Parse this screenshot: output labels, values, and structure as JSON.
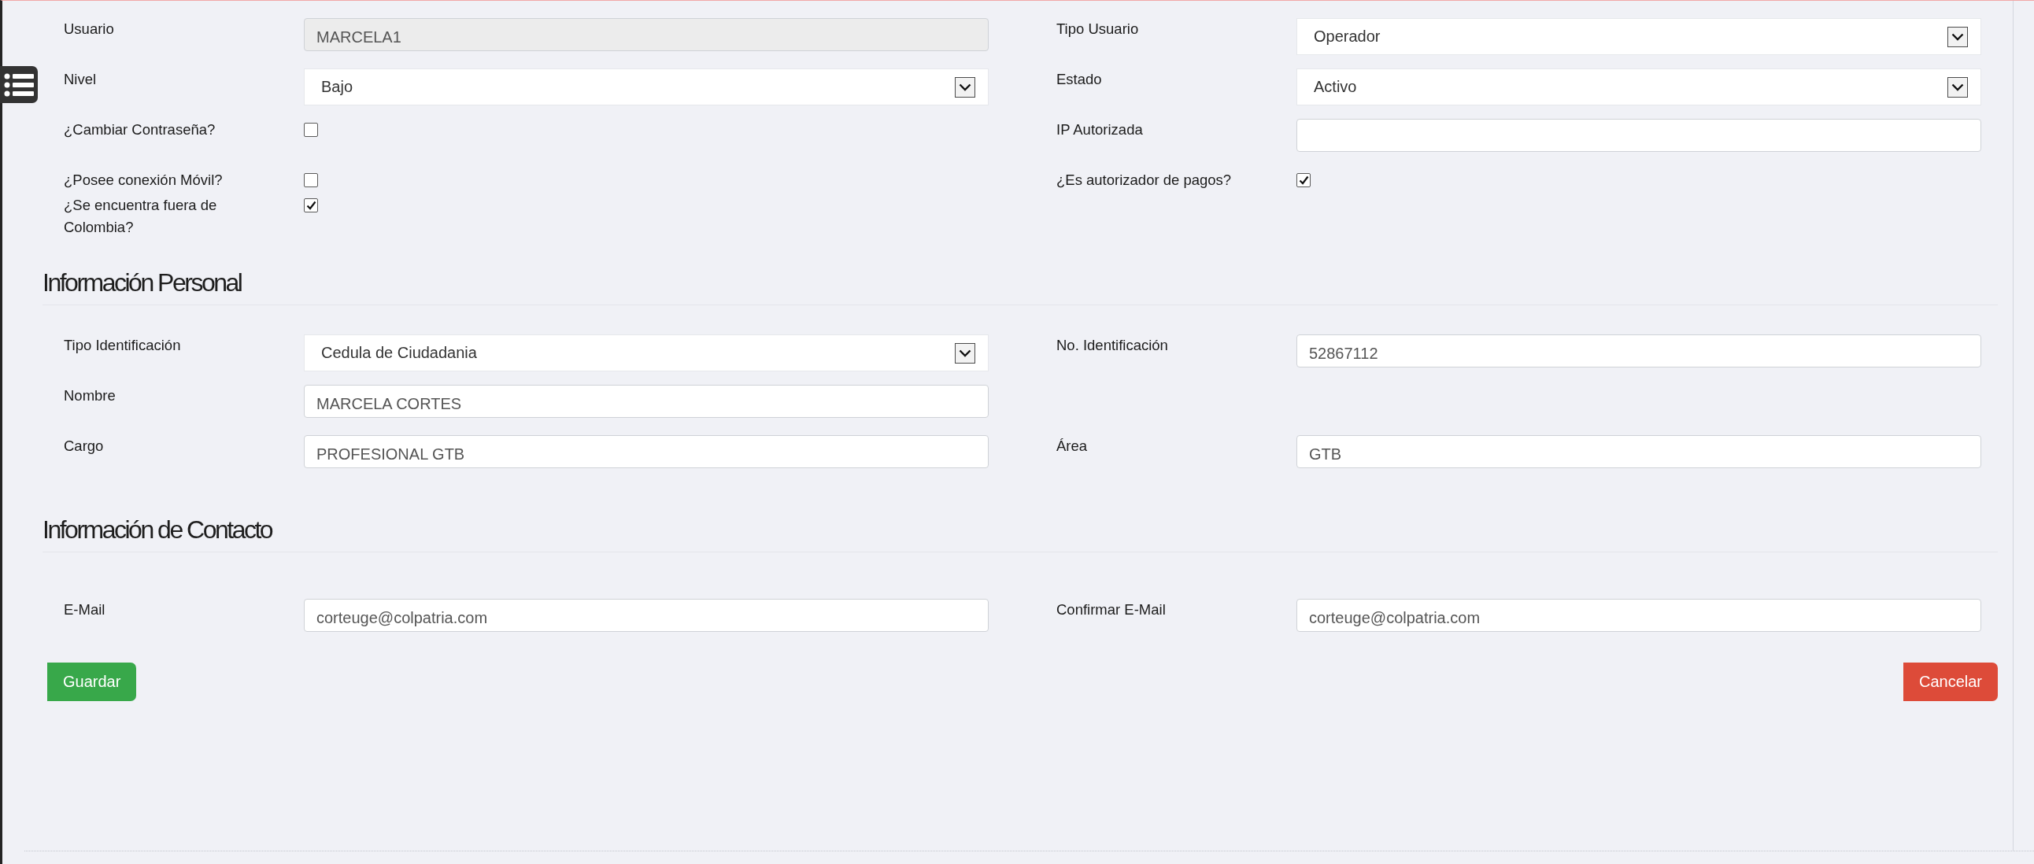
{
  "sections": [
    {
      "rows": [
        {
          "left": {
            "kind": "input",
            "label": "Usuario",
            "value": "MARCELA1",
            "disabled": true
          },
          "right": {
            "kind": "select",
            "label": "Tipo Usuario",
            "value": "Operador"
          }
        },
        {
          "left": {
            "kind": "select",
            "label": "Nivel",
            "value": "Bajo"
          },
          "right": {
            "kind": "select",
            "label": "Estado",
            "value": "Activo"
          }
        },
        {
          "left": {
            "kind": "checkbox",
            "label": "¿Cambiar Contraseña?",
            "checked": false
          },
          "right": {
            "kind": "input",
            "label": "IP Autorizada",
            "disabled": false
          }
        },
        {
          "left": {
            "kind": "checkbox",
            "label": "¿Posee conexión Móvil?",
            "checked": false
          },
          "right": {
            "kind": "checkbox",
            "label": "¿Es autorizador de pagos?",
            "checked": true
          }
        },
        {
          "left": {
            "kind": "checkbox",
            "label": "¿Se encuentra fuera de Colombia?",
            "checked": true
          }
        }
      ]
    },
    {
      "title": "Información Personal",
      "rows": [
        {
          "left": {
            "kind": "select",
            "label": "Tipo Identificación",
            "value": "Cedula de Ciudadania"
          },
          "right": {
            "kind": "input",
            "label": "No. Identificación",
            "value": "52867112",
            "disabled": false
          }
        },
        {
          "left": {
            "kind": "input",
            "label": "Nombre",
            "value": "MARCELA CORTES",
            "disabled": false
          }
        },
        {
          "left": {
            "kind": "input",
            "label": "Cargo",
            "value": "PROFESIONAL GTB",
            "disabled": false
          },
          "right": {
            "kind": "input",
            "label": "Área",
            "value": "GTB",
            "disabled": false
          }
        }
      ]
    },
    {
      "title": "Información de Contacto",
      "rows": [
        {
          "left": {
            "kind": "input",
            "label": "E-Mail",
            "value": "corteuge@colpatria.com",
            "disabled": false
          },
          "right": {
            "kind": "input",
            "label": "Confirmar E-Mail",
            "value": "corteuge@colpatria.com",
            "disabled": false
          }
        }
      ]
    }
  ],
  "actions": [
    {
      "kind": "save",
      "label": "Guardar"
    },
    {
      "kind": "cancel",
      "label": "Cancelar"
    }
  ]
}
